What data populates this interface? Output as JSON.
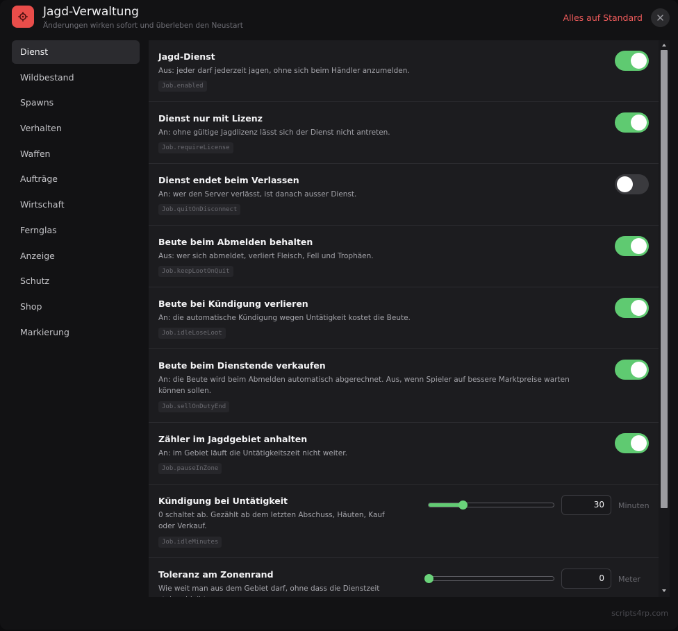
{
  "app": {
    "title": "Jagd-Verwaltung",
    "subtitle": "Änderungen wirken sofort und überleben den Neustart",
    "icon": "gear-icon",
    "reset_label": "Alles auf Standard",
    "close_icon": "close-icon"
  },
  "sidebar": {
    "items": [
      {
        "label": "Dienst",
        "active": true
      },
      {
        "label": "Wildbestand"
      },
      {
        "label": "Spawns"
      },
      {
        "label": "Verhalten"
      },
      {
        "label": "Waffen"
      },
      {
        "label": "Aufträge"
      },
      {
        "label": "Wirtschaft"
      },
      {
        "label": "Fernglas"
      },
      {
        "label": "Anzeige"
      },
      {
        "label": "Schutz"
      },
      {
        "label": "Shop"
      },
      {
        "label": "Markierung"
      }
    ]
  },
  "settings": [
    {
      "title": "Jagd-Dienst",
      "desc": "Aus: jeder darf jederzeit jagen, ohne sich beim Händler anzumelden.",
      "key": "Job.enabled",
      "type": "toggle",
      "on": true
    },
    {
      "title": "Dienst nur mit Lizenz",
      "desc": "An: ohne gültige Jagdlizenz lässt sich der Dienst nicht antreten.",
      "key": "Job.requireLicense",
      "type": "toggle",
      "on": true
    },
    {
      "title": "Dienst endet beim Verlassen",
      "desc": "An: wer den Server verlässt, ist danach ausser Dienst.",
      "key": "Job.quitOnDisconnect",
      "type": "toggle",
      "on": false
    },
    {
      "title": "Beute beim Abmelden behalten",
      "desc": "Aus: wer sich abmeldet, verliert Fleisch, Fell und Trophäen.",
      "key": "Job.keepLootOnQuit",
      "type": "toggle",
      "on": true
    },
    {
      "title": "Beute bei Kündigung verlieren",
      "desc": "An: die automatische Kündigung wegen Untätigkeit kostet die Beute.",
      "key": "Job.idleLoseLoot",
      "type": "toggle",
      "on": true
    },
    {
      "title": "Beute beim Dienstende verkaufen",
      "desc": "An: die Beute wird beim Abmelden automatisch abgerechnet. Aus, wenn Spieler auf bessere Marktpreise warten können sollen.",
      "key": "Job.sellOnDutyEnd",
      "type": "toggle",
      "on": true
    },
    {
      "title": "Zähler im Jagdgebiet anhalten",
      "desc": "An: im Gebiet läuft die Untätigkeitszeit nicht weiter.",
      "key": "Job.pauseInZone",
      "type": "toggle",
      "on": true
    },
    {
      "title": "Kündigung bei Untätigkeit",
      "desc": "0 schaltet ab. Gezählt ab dem letzten Abschuss, Häuten, Kauf oder Verkauf.",
      "key": "Job.idleMinutes",
      "type": "slider",
      "value": "30",
      "fraction": 0.27,
      "unit": "Minuten"
    },
    {
      "title": "Toleranz am Zonenrand",
      "desc": "Wie weit man aus dem Gebiet darf, ohne dass die Dienstzeit stehen bleibt.",
      "key": "",
      "type": "slider",
      "value": "0",
      "fraction": 0.0,
      "unit": "Meter"
    }
  ],
  "footer": "scripts4rp.com",
  "colors": {
    "accent": "#5fca71",
    "danger": "#ef5b5b",
    "app_icon_bg": "#e94d4a",
    "panel": "#1c1c1f",
    "background": "#121214"
  }
}
